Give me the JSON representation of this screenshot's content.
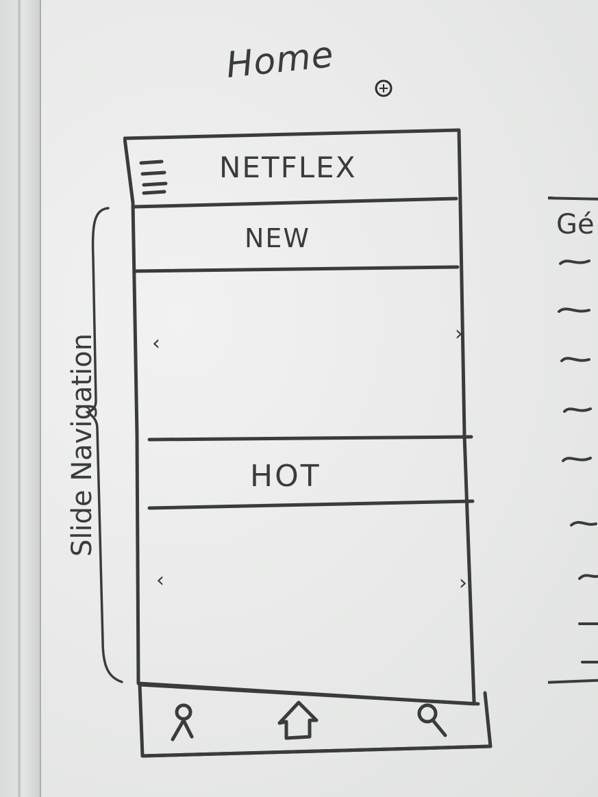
{
  "sketch": {
    "page_title": "Home",
    "app_header": {
      "menu_icon": "hamburger-menu-icon",
      "title": "NETFLEX"
    },
    "sections": [
      {
        "label": "NEW",
        "prev_arrow": "‹",
        "next_arrow": "›"
      },
      {
        "label": "HOT",
        "prev_arrow": "‹",
        "next_arrow": "›"
      }
    ],
    "side_annotation": "Slide Navigation",
    "bottom_nav": [
      {
        "icon": "profile-icon"
      },
      {
        "icon": "home-icon"
      },
      {
        "icon": "search-icon"
      }
    ],
    "right_panel": {
      "title": "Gé",
      "list_item_count_marks": 9
    }
  },
  "colors": {
    "marker": "#3a3b3d",
    "board": "#e9ebea"
  }
}
